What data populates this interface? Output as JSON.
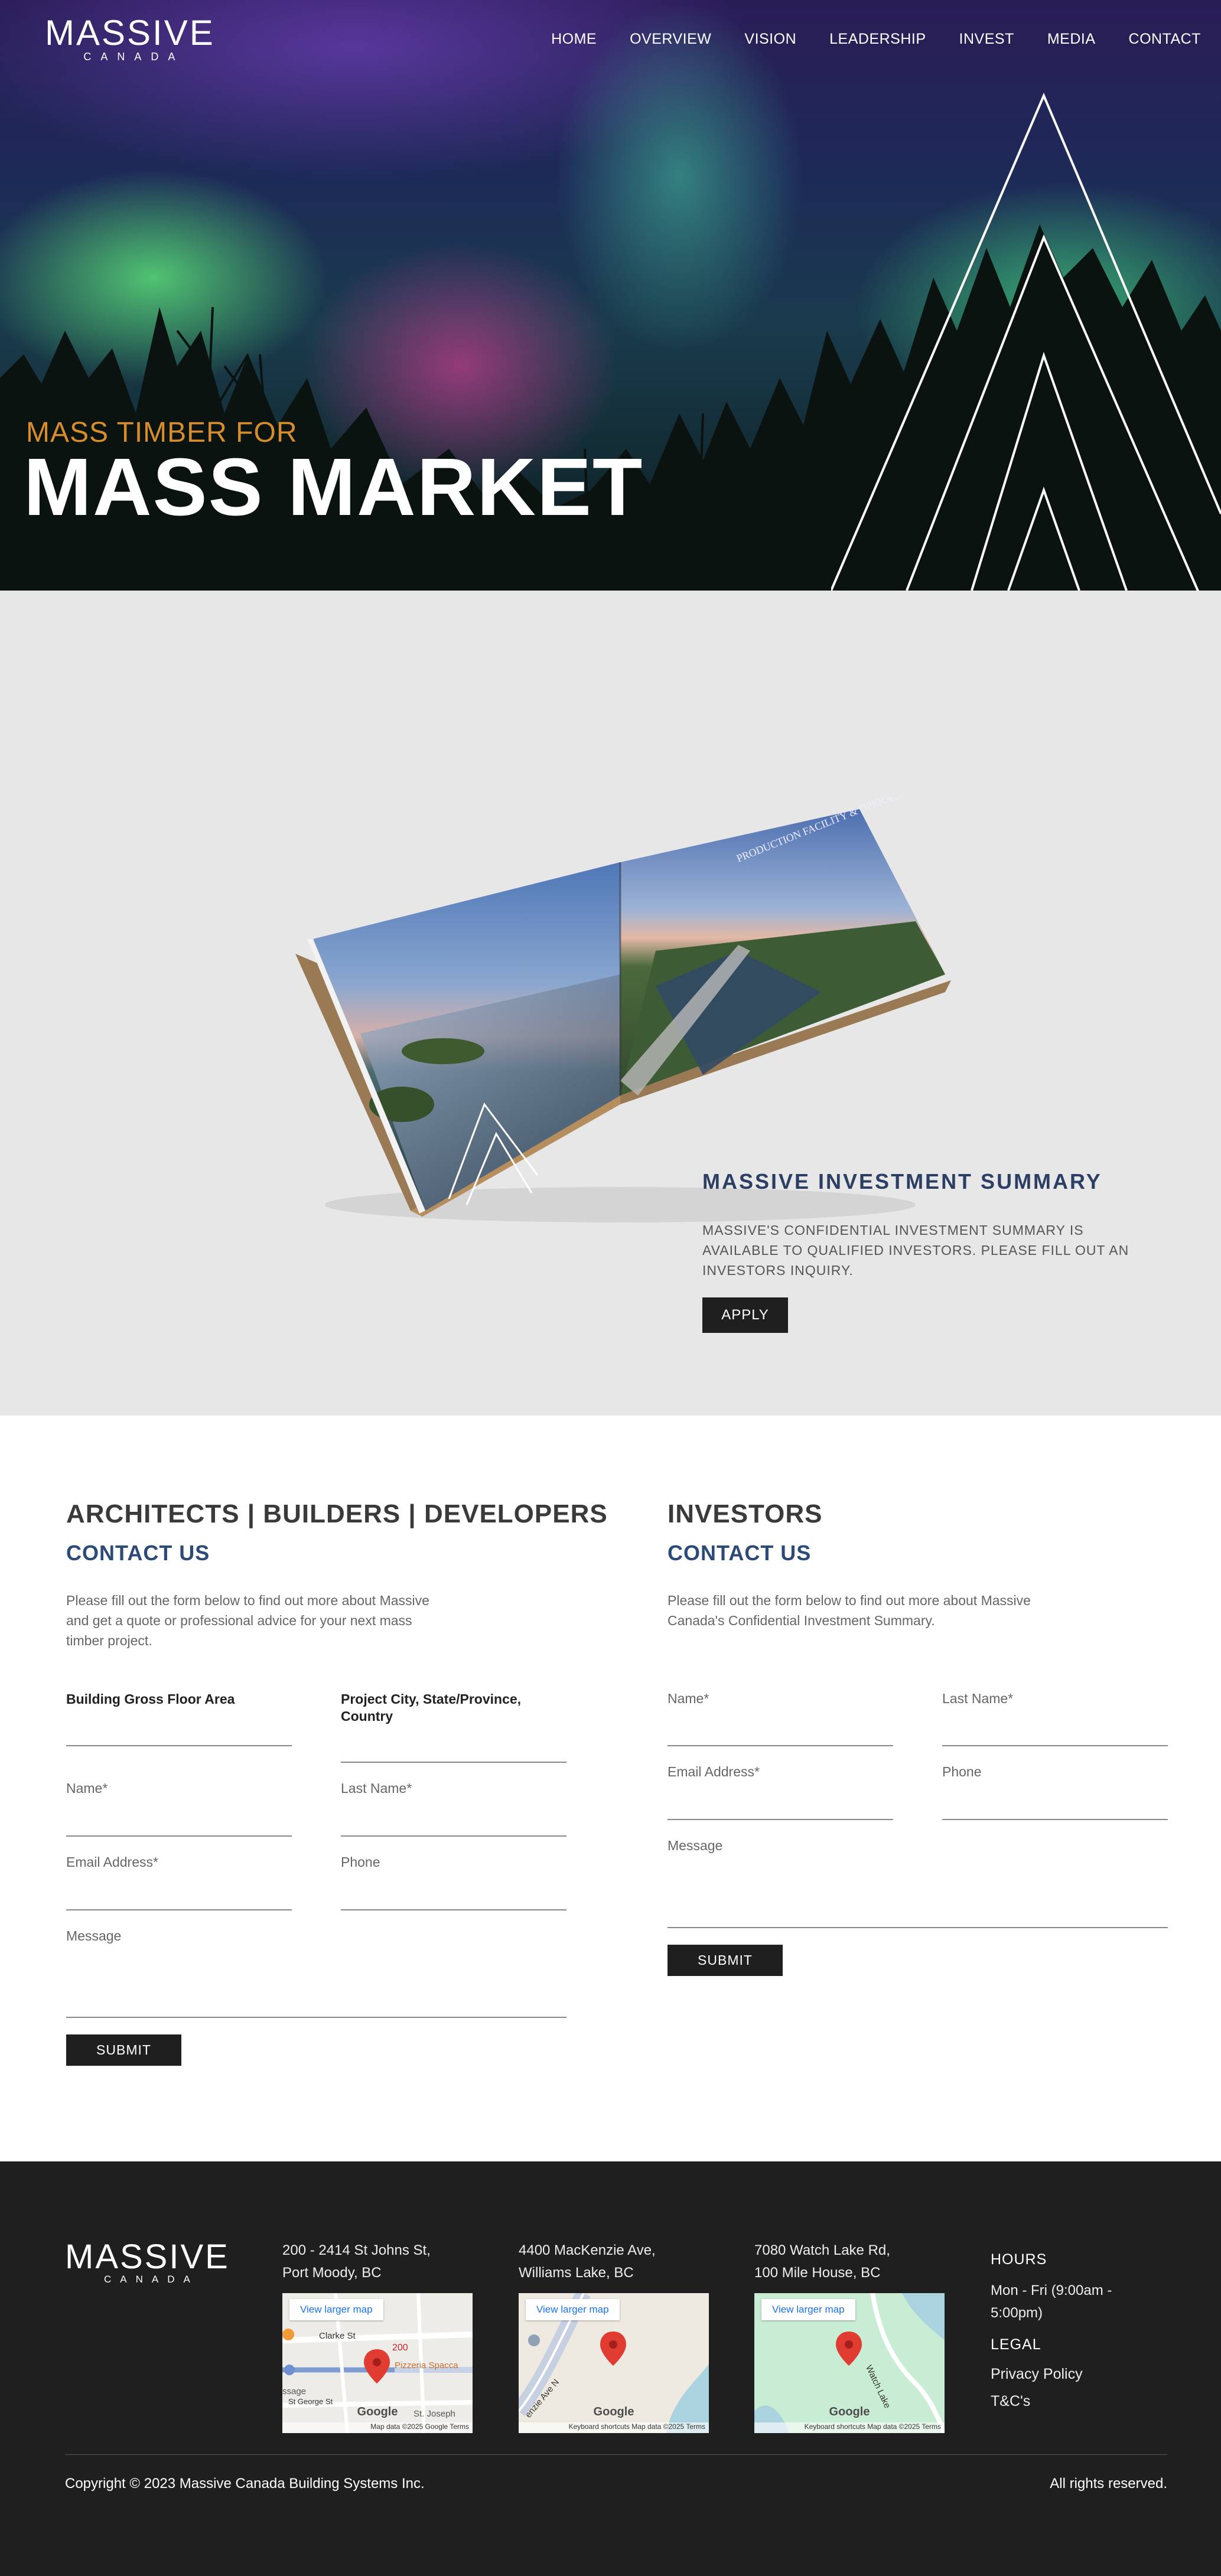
{
  "brand": {
    "name": "MASSIVE",
    "sub": "CANADA"
  },
  "nav": {
    "items": [
      {
        "label": "HOME"
      },
      {
        "label": "OVERVIEW"
      },
      {
        "label": "VISION"
      },
      {
        "label": "LEADERSHIP"
      },
      {
        "label": "INVEST"
      },
      {
        "label": "MEDIA"
      },
      {
        "label": "CONTACT"
      }
    ]
  },
  "hero": {
    "eyebrow": "MASS TIMBER FOR",
    "title": "MASS MARKET",
    "accent_color": "#d68d2c"
  },
  "summary": {
    "book_cover_text": "PRODUCTION FACILITY & OPERATION PLAN",
    "title": "MASSIVE  INVESTMENT  SUMMARY",
    "text": "MASSIVE'S CONFIDENTIAL INVESTMENT SUMMARY IS AVAILABLE TO QUALIFIED INVESTORS. PLEASE FILL OUT AN INVESTORS INQUIRY.",
    "apply_label": "APPLY"
  },
  "contact_architects": {
    "title": "ARCHITECTS | BUILDERS | DEVELOPERS",
    "subtitle": "CONTACT US",
    "description": "Please fill out the form below to find out more about Massive and get a quote or professional advice for your next mass timber project.",
    "fields": {
      "gross_floor_area": "Building Gross Floor Area",
      "project_location": "Project City, State/Province, Country",
      "name": "Name*",
      "last_name": "Last Name*",
      "email": "Email Address*",
      "phone": "Phone",
      "message": "Message"
    },
    "submit_label": "SUBMIT"
  },
  "contact_investors": {
    "title": "INVESTORS",
    "subtitle": "CONTACT US",
    "description": "Please fill out the form below to find out more about Massive Canada's Confidential Investment Summary.",
    "fields": {
      "name": "Name*",
      "last_name": "Last Name*",
      "email": "Email Address*",
      "phone": "Phone",
      "message": "Message"
    },
    "submit_label": "SUBMIT"
  },
  "footer": {
    "locations": [
      {
        "line1": "200 - 2414 St Johns St,",
        "line2": "Port Moody, BC",
        "map_button": "View larger map",
        "map_labels": [
          "Clarke St",
          "200",
          "Pizzeria Spacca",
          "St George St",
          "St. Joseph",
          "ssage"
        ],
        "map_attr": "Map data ©2025 Google    Terms"
      },
      {
        "line1": "4400 MacKenzie Ave,",
        "line2": "Williams Lake, BC",
        "map_button": "View larger map",
        "map_labels": [
          "enzie Ave N"
        ],
        "map_attr": "Keyboard shortcuts   Map data ©2025   Terms"
      },
      {
        "line1": "7080 Watch Lake Rd,",
        "line2": "100 Mile House, BC",
        "map_button": "View larger map",
        "map_labels": [
          "Watch Lake"
        ],
        "map_attr": "Keyboard shortcuts   Map data ©2025   Terms"
      }
    ],
    "map_brand": "Google",
    "hours_title": "HOURS",
    "hours_text": "Mon - Fri (9:00am - 5:00pm)",
    "legal_title": "LEGAL",
    "privacy_label": "Privacy Policy",
    "terms_label": "T&C's",
    "copyright": "Copyright © 2023 Massive Canada Building Systems Inc.",
    "rights": "All rights reserved."
  }
}
